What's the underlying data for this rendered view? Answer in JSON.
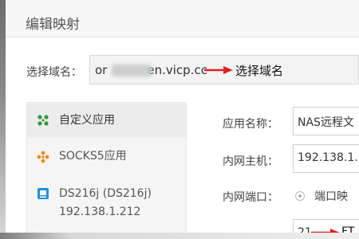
{
  "dialog": {
    "title": "编辑映射",
    "domain_label": "选择域名：",
    "domain_value_prefix": "or",
    "domain_value_suffix": "en.vicp.cc",
    "domain_annotation": "选择域名"
  },
  "app_list": [
    {
      "label": "自定义应用",
      "icon": "custom-app-icon",
      "selected": true
    },
    {
      "label": "SOCKS5应用",
      "icon": "socks5-icon",
      "selected": false
    },
    {
      "label": "DS216j (DS216j)",
      "sublabel": "192.138.1.212",
      "icon": "nas-device-icon",
      "selected": false
    }
  ],
  "form": {
    "app_name_label": "应用名称：",
    "app_name_value": "NAS远程文",
    "internal_host_label": "内网主机：",
    "internal_host_value": "192.138.1.2",
    "internal_port_label": "内网端口：",
    "port_option_label": "端口映",
    "port_value": "21",
    "port_annotation": "FT"
  },
  "colors": {
    "annotation_arrow": "#e02020",
    "custom_icon": "#2f9a3d",
    "socks_icon": "#ef8a1f",
    "nas_icon": "#1e90d8"
  }
}
